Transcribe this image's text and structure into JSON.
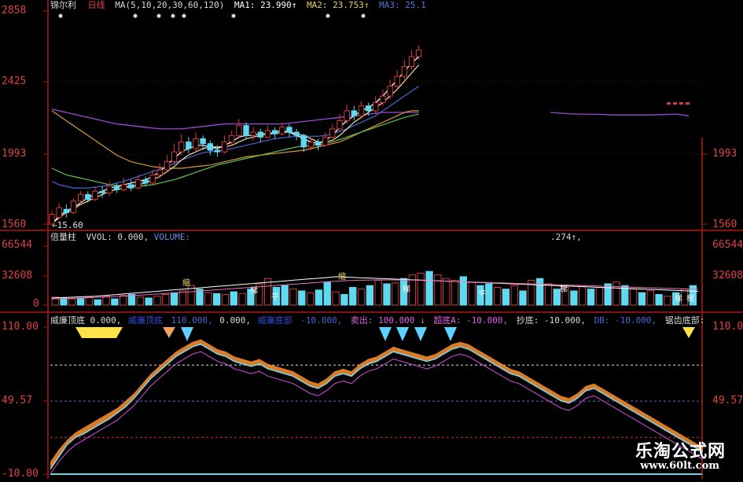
{
  "colors": {
    "bg": "#000000",
    "frame": "#b01818",
    "grid": "#8a1010",
    "up": "#d23c3c",
    "down": "#5fd9f0",
    "ma_yellow": "#f3e2a0",
    "ma_white": "#ffffff",
    "ma_purple": "#a046d6",
    "ma_green": "#62c24d",
    "ma_blue": "#4667d6",
    "ma_orange": "#d7973a",
    "fill_orange": "#f08a2c",
    "line_cyan": "#7fd0e6",
    "line_magenta": "#c04ad0",
    "dash_white": "#e0e0e0",
    "dash_red": "#d03030",
    "yellow": "#ffe24a"
  },
  "price_panel": {
    "header": {
      "name": "锦尔利",
      "period": "日线",
      "ma_params": "MA(5,10,20,30,60,120)",
      "ma1": "MA1: 23.990↑",
      "ma2": "MA2: 23.753↑",
      "ma3": "MA3: 25.1"
    },
    "left_ticks": [
      "2858",
      "2425",
      "1993",
      "1560"
    ],
    "right_ticks": [
      "1993",
      "1560"
    ],
    "low_marker": "←15.60"
  },
  "volume_panel": {
    "header": {
      "name": "倍量柱",
      "vvol": "VVOL: 0.000,",
      "volume": "VOLUME:",
      "right_value": ".274↑,"
    },
    "left_ticks": [
      "66544",
      "32608",
      "0"
    ],
    "right_ticks": [
      "66544",
      "32608"
    ],
    "bar_labels": [
      "缩",
      "梯",
      "平",
      "缩",
      "梯",
      "平",
      "梯",
      "梯",
      "梯"
    ]
  },
  "indicator_panel": {
    "header": [
      {
        "text": "威廉顶底  0.000,",
        "color": "#d8d8d8"
      },
      {
        "text": "威廉顶底",
        "color": "#2b4fd8"
      },
      {
        "text": "110.000,",
        "color": "#4667d6"
      },
      {
        "text": "0.000,",
        "color": "#d8d8d8"
      },
      {
        "text": "威廉底部",
        "color": "#2b4fd8"
      },
      {
        "text": "-10.000,",
        "color": "#4667d6"
      },
      {
        "text": "卖出: 100.000 ↓",
        "color": "#e060e0"
      },
      {
        "text": "超底A: -10.000,",
        "color": "#e060e0"
      },
      {
        "text": "抄底: -10.000,",
        "color": "#d8d8d8"
      },
      {
        "text": "DB: -10.000,",
        "color": "#4667d6"
      },
      {
        "text": "锯齿底部:",
        "color": "#d8d8d8"
      }
    ],
    "left_ticks": [
      "110.00",
      "49.57",
      "-10.00"
    ],
    "right_ticks": [
      "110.00",
      "49.57"
    ]
  },
  "watermark": {
    "line1": "乐淘公式网",
    "line2": "www.60lt.com"
  },
  "chart_data": {
    "type": "line",
    "price": {
      "ylim": [
        15.6,
        28.58
      ],
      "n": 62,
      "candles": [
        [
          15.6,
          16.2,
          15.6,
          16.4
        ],
        [
          16.0,
          16.6,
          15.9,
          16.9
        ],
        [
          16.5,
          16.3,
          16.0,
          16.8
        ],
        [
          16.3,
          17.0,
          16.2,
          17.2
        ],
        [
          17.0,
          17.4,
          16.8,
          17.6
        ],
        [
          17.4,
          17.1,
          16.9,
          17.6
        ],
        [
          17.1,
          17.6,
          17.0,
          17.9
        ],
        [
          17.6,
          17.5,
          17.2,
          17.9
        ],
        [
          17.5,
          17.9,
          17.3,
          18.2
        ],
        [
          17.9,
          17.7,
          17.5,
          18.1
        ],
        [
          17.7,
          18.0,
          17.6,
          18.4
        ],
        [
          18.0,
          17.8,
          17.6,
          18.3
        ],
        [
          17.8,
          18.3,
          17.7,
          18.6
        ],
        [
          18.3,
          18.1,
          17.9,
          18.5
        ],
        [
          18.1,
          18.6,
          18.0,
          18.9
        ],
        [
          18.6,
          18.9,
          18.4,
          19.3
        ],
        [
          18.9,
          19.4,
          18.7,
          19.8
        ],
        [
          19.4,
          20.0,
          19.2,
          20.5
        ],
        [
          20.0,
          20.6,
          19.8,
          21.1
        ],
        [
          20.6,
          20.2,
          19.9,
          20.9
        ],
        [
          20.2,
          20.8,
          20.0,
          21.2
        ],
        [
          20.8,
          20.5,
          20.1,
          21.0
        ],
        [
          20.5,
          20.1,
          19.8,
          20.7
        ],
        [
          20.1,
          20.0,
          19.7,
          20.4
        ],
        [
          20.0,
          20.6,
          19.9,
          21.0
        ],
        [
          20.6,
          21.0,
          20.4,
          21.3
        ],
        [
          21.0,
          21.6,
          20.8,
          22.0
        ],
        [
          21.6,
          21.0,
          20.8,
          21.8
        ],
        [
          21.0,
          21.2,
          20.7,
          21.5
        ],
        [
          21.2,
          20.9,
          20.6,
          21.4
        ],
        [
          20.9,
          21.3,
          20.8,
          21.6
        ],
        [
          21.3,
          21.1,
          20.8,
          21.5
        ],
        [
          21.1,
          21.5,
          21.0,
          21.8
        ],
        [
          21.5,
          21.2,
          20.9,
          21.7
        ],
        [
          21.2,
          21.0,
          20.7,
          21.4
        ],
        [
          21.0,
          20.3,
          20.0,
          21.1
        ],
        [
          20.3,
          20.6,
          20.1,
          20.9
        ],
        [
          20.6,
          20.4,
          20.1,
          20.8
        ],
        [
          20.4,
          20.9,
          20.3,
          21.2
        ],
        [
          20.9,
          21.4,
          20.8,
          21.7
        ],
        [
          21.4,
          21.9,
          21.2,
          22.3
        ],
        [
          21.9,
          22.5,
          21.7,
          22.9
        ],
        [
          22.5,
          22.2,
          21.9,
          22.8
        ],
        [
          22.2,
          22.8,
          22.0,
          23.1
        ],
        [
          22.8,
          22.5,
          22.2,
          23.0
        ],
        [
          22.5,
          23.0,
          22.3,
          23.4
        ],
        [
          23.0,
          23.4,
          22.8,
          23.8
        ],
        [
          23.4,
          24.0,
          23.2,
          24.4
        ],
        [
          24.0,
          24.6,
          23.8,
          25.0
        ],
        [
          24.6,
          25.2,
          24.4,
          25.6
        ],
        [
          25.2,
          25.8,
          25.0,
          26.2
        ],
        [
          25.8,
          26.2,
          25.6,
          26.5
        ]
      ],
      "ma_yellow": [
        15.6,
        16.0,
        16.3,
        16.5,
        16.8,
        17.0,
        17.2,
        17.4,
        17.6,
        17.7,
        17.8,
        17.9,
        18.0,
        18.1,
        18.3,
        18.5,
        18.8,
        19.1,
        19.5,
        19.8,
        20.0,
        20.2,
        20.3,
        20.3,
        20.3,
        20.4,
        20.6,
        20.8,
        20.9,
        21.0,
        21.1,
        21.1,
        21.2,
        21.2,
        21.1,
        21.0,
        20.8,
        20.6,
        20.6,
        20.7,
        21.0,
        21.4,
        21.8,
        22.1,
        22.4,
        22.7,
        23.0,
        23.4,
        23.8,
        24.3,
        24.8,
        25.3
      ],
      "ma_purple_left": [
        22.6,
        22.5,
        22.4,
        22.3,
        22.2,
        22.1,
        22.0,
        21.9,
        21.8,
        21.7,
        21.65,
        21.6,
        21.55,
        21.5,
        21.45,
        21.4,
        21.4,
        21.4,
        21.4,
        21.45,
        21.5,
        21.55,
        21.6,
        21.65,
        21.7,
        21.7,
        21.7,
        21.7,
        21.7,
        21.7,
        21.7,
        21.7,
        21.7,
        21.75,
        21.8,
        21.85,
        21.9,
        21.95,
        22.0,
        22.05,
        22.1,
        22.15,
        22.2,
        22.25,
        22.3,
        22.35,
        22.4,
        22.4,
        22.4,
        22.4,
        22.4,
        22.4
      ],
      "ma_purple_right": [
        22.4,
        22.35,
        22.3,
        22.3,
        22.28,
        22.25,
        22.25,
        22.25,
        22.25,
        22.27,
        22.3,
        22.2
      ],
      "ma_orange": [
        22.5,
        22.2,
        21.9,
        21.6,
        21.3,
        21.0,
        20.7,
        20.4,
        20.1,
        19.8,
        19.6,
        19.4,
        19.3,
        19.2,
        19.1,
        19.05,
        19.0,
        19.0,
        19.0,
        19.05,
        19.1,
        19.15,
        19.2,
        19.3,
        19.4,
        19.5,
        19.6,
        19.7,
        19.75,
        19.8,
        19.85,
        19.9,
        19.95,
        20.0,
        20.05,
        20.1,
        20.2,
        20.3,
        20.4,
        20.5,
        20.6,
        20.8,
        21.0,
        21.2,
        21.4,
        21.6,
        21.8,
        22.0,
        22.2,
        22.4,
        22.5,
        22.5
      ],
      "ma_green": [
        19.0,
        18.8,
        18.6,
        18.5,
        18.4,
        18.3,
        18.2,
        18.1,
        18.0,
        17.95,
        17.9,
        17.9,
        17.9,
        17.95,
        18.0,
        18.1,
        18.2,
        18.3,
        18.45,
        18.6,
        18.75,
        18.9,
        19.05,
        19.2,
        19.3,
        19.4,
        19.5,
        19.6,
        19.7,
        19.8,
        19.9,
        20.0,
        20.1,
        20.2,
        20.3,
        20.35,
        20.4,
        20.45,
        20.5,
        20.6,
        20.75,
        20.9,
        21.05,
        21.2,
        21.35,
        21.5,
        21.65,
        21.8,
        21.95,
        22.1,
        22.2,
        22.3
      ],
      "ma_blue": [
        18.2,
        18.0,
        17.9,
        17.8,
        17.8,
        17.8,
        17.85,
        17.9,
        18.0,
        18.1,
        18.2,
        18.35,
        18.5,
        18.65,
        18.8,
        18.95,
        19.1,
        19.3,
        19.5,
        19.65,
        19.8,
        19.95,
        20.0,
        20.05,
        20.1,
        20.2,
        20.3,
        20.4,
        20.5,
        20.6,
        20.7,
        20.8,
        20.85,
        20.9,
        20.95,
        20.95,
        20.95,
        20.95,
        21.0,
        21.1,
        21.25,
        21.4,
        21.6,
        21.8,
        22.0,
        22.2,
        22.5,
        22.8,
        23.1,
        23.4,
        23.7,
        23.99
      ],
      "ma_white": [
        15.6,
        16.1,
        16.4,
        16.6,
        16.9,
        17.2,
        17.4,
        17.6,
        17.8,
        17.9,
        18.0,
        18.1,
        18.2,
        18.3,
        18.5,
        18.8,
        19.2,
        19.6,
        20.0,
        20.2,
        20.4,
        20.4,
        20.3,
        20.2,
        20.4,
        20.6,
        20.9,
        21.0,
        21.0,
        21.1,
        21.1,
        21.2,
        21.3,
        21.2,
        21.0,
        20.8,
        20.6,
        20.5,
        20.7,
        21.0,
        21.5,
        21.9,
        22.2,
        22.5,
        22.7,
        23.0,
        23.4,
        23.9,
        24.4,
        24.9,
        25.4,
        25.8
      ]
    },
    "volume": {
      "ylim": [
        0,
        66544
      ],
      "bars": [
        [
          9000,
          1
        ],
        [
          8000,
          0
        ],
        [
          7000,
          1
        ],
        [
          8000,
          0
        ],
        [
          9000,
          1
        ],
        [
          6000,
          0
        ],
        [
          10000,
          1
        ],
        [
          7000,
          0
        ],
        [
          11000,
          1
        ],
        [
          12000,
          0
        ],
        [
          9000,
          1
        ],
        [
          8000,
          0
        ],
        [
          10000,
          1
        ],
        [
          12000,
          1
        ],
        [
          14000,
          0
        ],
        [
          16000,
          1
        ],
        [
          22000,
          1
        ],
        [
          18000,
          0
        ],
        [
          14000,
          1
        ],
        [
          13000,
          0
        ],
        [
          12000,
          1
        ],
        [
          15000,
          0
        ],
        [
          13000,
          1
        ],
        [
          18000,
          0
        ],
        [
          24000,
          1
        ],
        [
          30000,
          1
        ],
        [
          20000,
          0
        ],
        [
          22000,
          0
        ],
        [
          18000,
          1
        ],
        [
          16000,
          0
        ],
        [
          14000,
          1
        ],
        [
          17000,
          0
        ],
        [
          26000,
          0
        ],
        [
          15000,
          1
        ],
        [
          12000,
          0
        ],
        [
          20000,
          0
        ],
        [
          18000,
          1
        ],
        [
          22000,
          0
        ],
        [
          28000,
          1
        ],
        [
          24000,
          0
        ],
        [
          25000,
          1
        ],
        [
          30000,
          0
        ],
        [
          34000,
          1
        ],
        [
          36000,
          1
        ],
        [
          38000,
          0
        ],
        [
          34000,
          1
        ],
        [
          30000,
          1
        ],
        [
          28000,
          1
        ],
        [
          32000,
          0
        ],
        [
          26000,
          1
        ],
        [
          22000,
          0
        ],
        [
          24000,
          0
        ],
        [
          20000,
          1
        ],
        [
          18000,
          0
        ],
        [
          22000,
          1
        ],
        [
          16000,
          0
        ],
        [
          28000,
          1
        ],
        [
          30000,
          0
        ],
        [
          24000,
          1
        ],
        [
          18000,
          0
        ],
        [
          20000,
          1
        ],
        [
          16000,
          0
        ],
        [
          22000,
          1
        ],
        [
          18000,
          0
        ],
        [
          20000,
          1
        ],
        [
          24000,
          0
        ],
        [
          26000,
          1
        ],
        [
          22000,
          0
        ],
        [
          18000,
          1
        ],
        [
          14000,
          0
        ],
        [
          16000,
          1
        ],
        [
          12000,
          0
        ],
        [
          10000,
          1
        ],
        [
          14000,
          0
        ],
        [
          18000,
          1
        ],
        [
          22000,
          0
        ]
      ],
      "ma_white": [
        8000,
        8500,
        9000,
        9500,
        10000,
        11000,
        12000,
        13000,
        14000,
        15000,
        16000,
        17000,
        18000,
        19000,
        20000,
        21000,
        22000,
        23000,
        24000,
        25000,
        26000,
        27000,
        28000,
        29000,
        30000,
        31000,
        32000,
        31500,
        31000,
        30500,
        30000,
        29500,
        29000,
        28500,
        28000,
        27500,
        27000,
        26500,
        26000,
        25500,
        25000,
        24500,
        24000,
        23500,
        23000,
        22500,
        22000,
        21500,
        21000,
        20500,
        20000,
        19500,
        19000,
        18500,
        18000,
        17500,
        17000,
        16500,
        16000,
        15500
      ],
      "ma_pink": [
        7000,
        7400,
        7800,
        8200,
        8600,
        9200,
        9800,
        10500,
        11200,
        12000,
        12800,
        13600,
        14500,
        15400,
        16300,
        17200,
        18100,
        19000,
        19900,
        20800,
        21700,
        22600,
        23500,
        24400,
        25300,
        26200,
        27000,
        27600,
        28000,
        28300,
        28400,
        28400,
        28300,
        28100,
        27800,
        27400,
        27000,
        26600,
        26200,
        25800,
        25400,
        25000,
        24600,
        24200,
        23800,
        23400,
        23000,
        22600,
        22200,
        21800,
        21400,
        21000,
        20600,
        20200,
        19800,
        19400,
        19000,
        18600,
        18200,
        17800
      ]
    },
    "indicator": {
      "ylim": [
        -10,
        110
      ],
      "line_a": [
        -6,
        4,
        14,
        20,
        23,
        27,
        31,
        35,
        40,
        45,
        52,
        60,
        68,
        74,
        80,
        86,
        90,
        94,
        96,
        92,
        88,
        86,
        82,
        80,
        78,
        80,
        76,
        74,
        72,
        70,
        66,
        62,
        60,
        64,
        70,
        72,
        70,
        76,
        80,
        82,
        86,
        90,
        88,
        86,
        84,
        82,
        84,
        88,
        92,
        94,
        92,
        88,
        84,
        80,
        76,
        72,
        70,
        66,
        62,
        58,
        54,
        50,
        48,
        52,
        58,
        60,
        56,
        52,
        48,
        44,
        40,
        36,
        32,
        28,
        24,
        20,
        16,
        12,
        8
      ],
      "line_b": [
        -8,
        2,
        10,
        16,
        20,
        24,
        28,
        32,
        36,
        42,
        48,
        56,
        64,
        70,
        76,
        82,
        86,
        90,
        92,
        88,
        84,
        82,
        78,
        76,
        74,
        76,
        72,
        70,
        68,
        66,
        62,
        58,
        56,
        60,
        66,
        68,
        66,
        72,
        76,
        78,
        82,
        86,
        84,
        82,
        80,
        78,
        80,
        84,
        88,
        90,
        88,
        84,
        80,
        76,
        72,
        68,
        66,
        62,
        58,
        54,
        50,
        46,
        44,
        48,
        54,
        56,
        52,
        48,
        44,
        40,
        36,
        32,
        28,
        24,
        20,
        16,
        12,
        8,
        4
      ],
      "dash_white_upper": 79,
      "dash_white_mid": 49.57,
      "dash_red": 20,
      "cyan_bottom": -10
    }
  }
}
